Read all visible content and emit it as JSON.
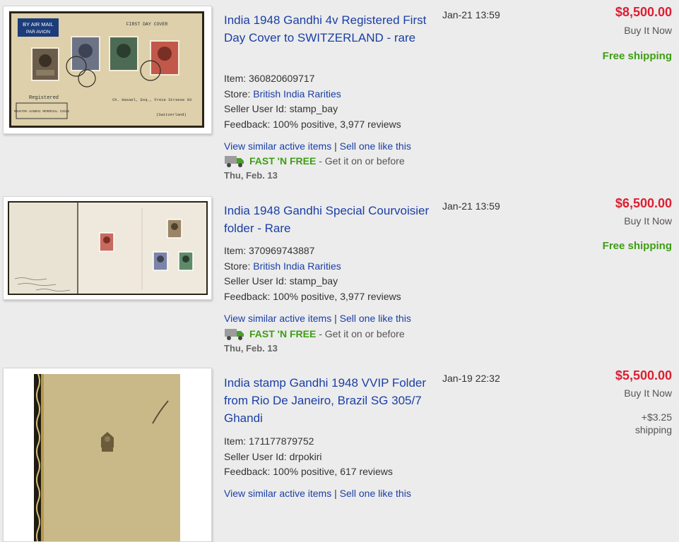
{
  "listings": [
    {
      "title": "India 1948 Gandhi 4v Registered First Day Cover to SWITZERLAND - rare",
      "item_label": "Item:",
      "item_id": "360820609717",
      "store_label": "Store:",
      "store_name": "British India Rarities",
      "seller_label": "Seller User Id:",
      "seller_id": "stamp_bay",
      "feedback_label": "Feedback:",
      "feedback": "100% positive, 3,977 reviews",
      "similar_link": "View similar active items",
      "sell_link": "Sell one like this",
      "fast_label": "FAST 'N FREE",
      "fast_rest": "- Get it on or before",
      "fast_date": "Thu, Feb. 13",
      "time": "Jan-21 13:59",
      "price": "$8,500.00",
      "buy_format": "Buy It Now",
      "shipping": "Free shipping",
      "cover_airmail": "BY AIR MAIL",
      "cover_paravion": "PAR AVION",
      "cover_fdc": "FIRST DAY COVER",
      "cover_registered": "Registered",
      "cover_memorial": "MAHATMA GANDHI MEMORIAL ISSUE",
      "cover_address": "Ch. Hasael, Esq., Freie Strasse 93",
      "cover_country": "(Switzerland)"
    },
    {
      "title": "India 1948 Gandhi Special Courvoisier folder - Rare",
      "item_label": "Item:",
      "item_id": "370969743887",
      "store_label": "Store:",
      "store_name": "British India Rarities",
      "seller_label": "Seller User Id:",
      "seller_id": "stamp_bay",
      "feedback_label": "Feedback:",
      "feedback": "100% positive, 3,977 reviews",
      "similar_link": "View similar active items",
      "sell_link": "Sell one like this",
      "fast_label": "FAST 'N FREE",
      "fast_rest": "- Get it on or before",
      "fast_date": "Thu, Feb. 13",
      "time": "Jan-21 13:59",
      "price": "$6,500.00",
      "buy_format": "Buy It Now",
      "shipping": "Free shipping"
    },
    {
      "title": "India stamp Gandhi 1948 VVIP Folder from Rio De Janeiro, Brazil SG 305/7 Ghandi",
      "item_label": "Item:",
      "item_id": "171177879752",
      "seller_label": "Seller User Id:",
      "seller_id": "drpokiri",
      "feedback_label": "Feedback:",
      "feedback": "100% positive, 617 reviews",
      "similar_link": "View similar active items",
      "sell_link": "Sell one like this",
      "time": "Jan-19 22:32",
      "price": "$5,500.00",
      "buy_format": "Buy It Now",
      "shipping_cost": "+$3.25",
      "shipping_word": "shipping"
    }
  ],
  "separator": "|",
  "colors": {
    "link": "#1a3fa6",
    "price": "#dd1e31",
    "free_shipping": "#3e9e14",
    "background": "#ececec"
  }
}
